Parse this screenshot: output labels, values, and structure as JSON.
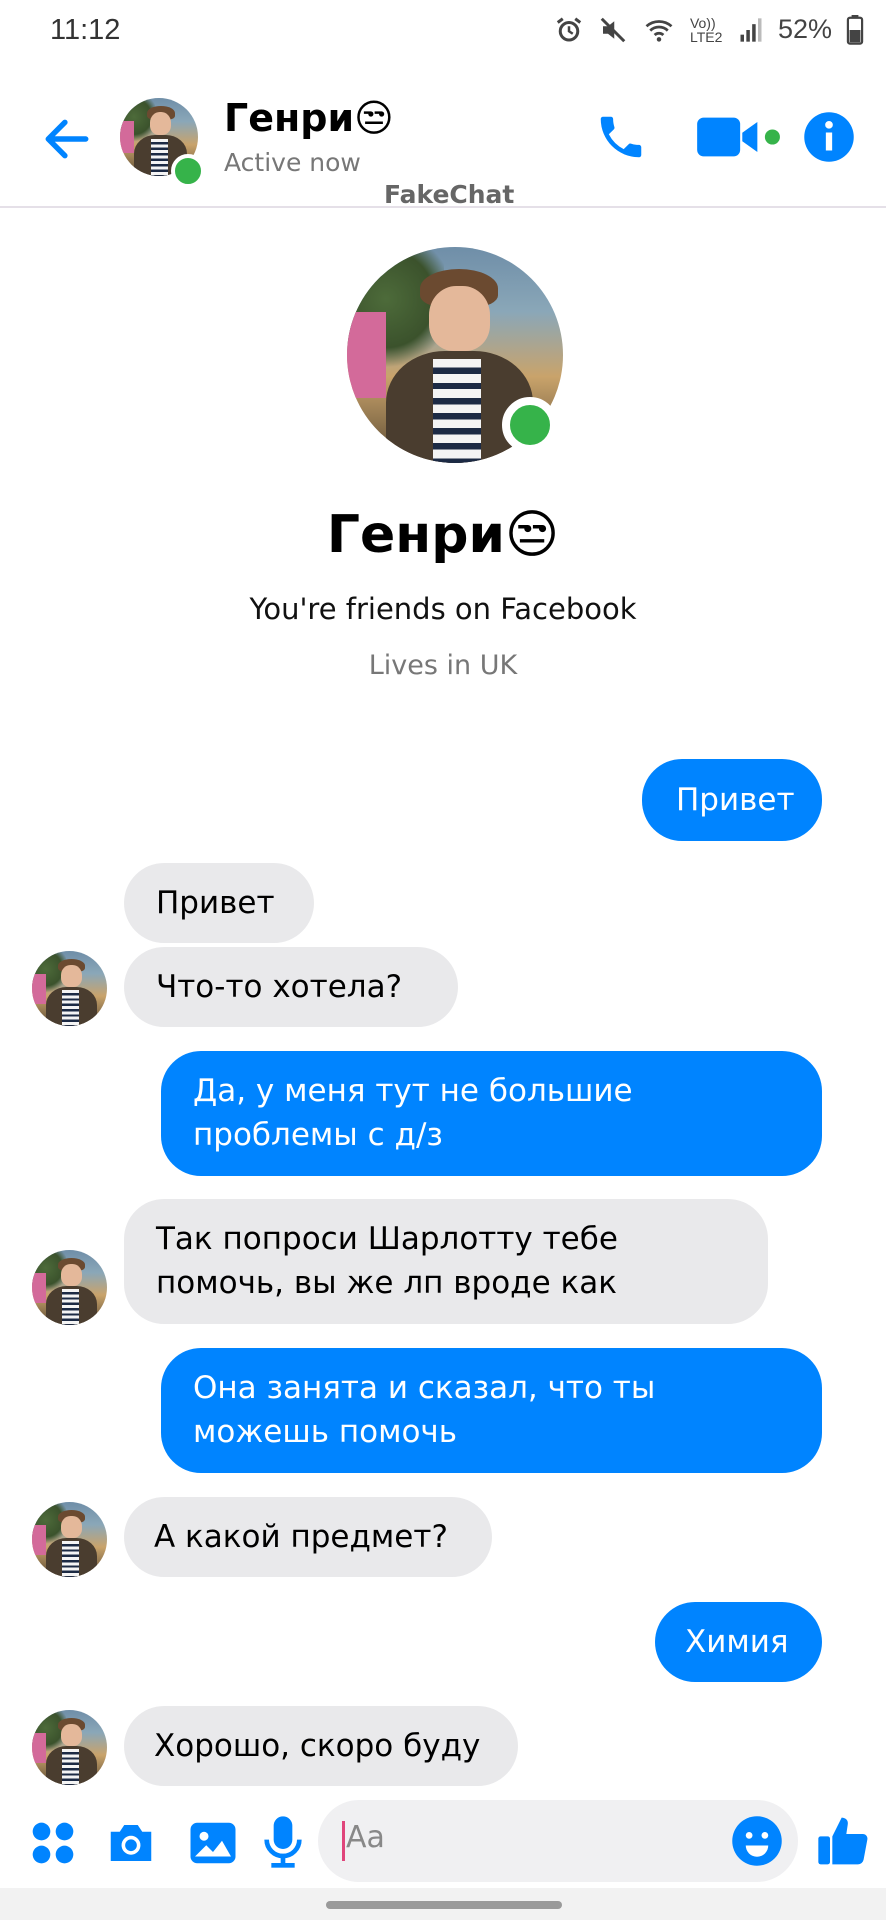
{
  "status_bar": {
    "time": "11:12",
    "battery": "52%",
    "network": "Vo)) LTE2"
  },
  "header": {
    "name": "Генри😒",
    "status": "Active now",
    "watermark": "FakeChat"
  },
  "profile": {
    "name": "Генри😒",
    "friends_text": "You're friends on Facebook",
    "lives_text": "Lives in UK"
  },
  "messages": [
    {
      "dir": "out",
      "text": "Привет"
    },
    {
      "dir": "in",
      "text": "Привет"
    },
    {
      "dir": "in",
      "text": "Что-то хотела?"
    },
    {
      "dir": "out",
      "text": "Да, у меня тут не большие проблемы с д/з"
    },
    {
      "dir": "in",
      "text": "Так попроси Шарлотту тебе помочь, вы же лп вроде как"
    },
    {
      "dir": "out",
      "text": "Она занята и сказал, что ты можешь помочь"
    },
    {
      "dir": "in",
      "text": "А какой предмет?"
    },
    {
      "dir": "out",
      "text": "Химия"
    },
    {
      "dir": "in",
      "text": "Хорошо, скоро буду"
    }
  ],
  "composer": {
    "placeholder": "Aa"
  },
  "colors": {
    "accent": "#0084ff",
    "online": "#36b34a",
    "incoming_bubble": "#e9e9eb"
  },
  "icons": [
    "back-arrow-icon",
    "phone-icon",
    "video-icon",
    "info-icon",
    "apps-icon",
    "camera-icon",
    "gallery-icon",
    "mic-icon",
    "emoji-icon",
    "like-icon"
  ]
}
